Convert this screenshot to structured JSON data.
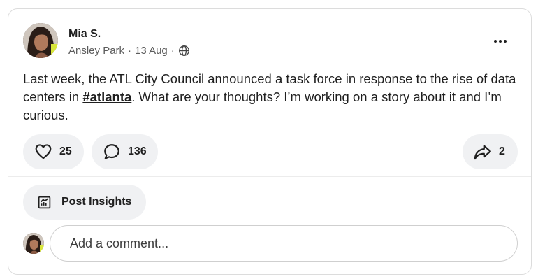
{
  "post": {
    "author": "Mia S.",
    "location": "Ansley Park",
    "separator": "·",
    "date": "13 Aug",
    "text_before": "Last week, the ATL City Council announced a task force in response to the rise of data centers in ",
    "hashtag": "#atlanta",
    "text_after": ". What are your thoughts? I’m working on a story about it and I’m curious."
  },
  "actions": {
    "likes": "25",
    "comments": "136",
    "shares": "2",
    "insights_label": "Post Insights"
  },
  "comment_box": {
    "placeholder": "Add a comment..."
  },
  "icons": {
    "like": "heart-icon",
    "comment": "speech-bubble-icon",
    "share": "share-arrow-icon",
    "insights": "chart-icon",
    "visibility": "globe-icon",
    "more": "more-options-icon"
  }
}
